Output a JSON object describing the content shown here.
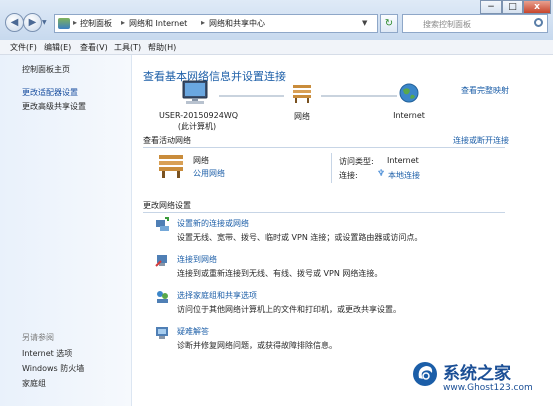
{
  "address_bar": {
    "crumbs": [
      "控制面板",
      "网络和 Internet",
      "网络和共享中心"
    ],
    "search_placeholder": "搜索控制面板"
  },
  "window_controls": {
    "minimize": "−",
    "maximize": "□",
    "close": "x"
  },
  "menu": [
    "文件(F)",
    "编辑(E)",
    "查看(V)",
    "工具(T)",
    "帮助(H)"
  ],
  "sidebar": {
    "items": [
      "控制面板主页",
      "更改适配器设置",
      "更改高级共享设置"
    ],
    "see_also_title": "另请参阅",
    "see_also": [
      "Internet 选项",
      "Windows 防火墙",
      "家庭组"
    ]
  },
  "main": {
    "title": "查看基本网络信息并设置连接",
    "view_full_map": "查看完整映射",
    "map": {
      "computer_name": "USER-20150924WQ",
      "computer_sub": "(此计算机)",
      "network": "网络",
      "internet": "Internet"
    },
    "active_title": "查看活动网络",
    "connect_disconnect": "连接或断开连接",
    "network_name": "网络",
    "network_type": "公用网络",
    "access_type_label": "访问类型:",
    "access_type_value": "Internet",
    "connections_label": "连接:",
    "connections_value": "本地连接",
    "change_title": "更改网络设置",
    "tasks": [
      {
        "title": "设置新的连接或网络",
        "desc": "设置无线、宽带、拨号、临时或 VPN 连接；或设置路由器或访问点。"
      },
      {
        "title": "连接到网络",
        "desc": "连接到或重新连接到无线、有线、拨号或 VPN 网络连接。"
      },
      {
        "title": "选择家庭组和共享选项",
        "desc": "访问位于其他网络计算机上的文件和打印机，或更改共享设置。"
      },
      {
        "title": "疑难解答",
        "desc": "诊断并修复网络问题，或获得故障排除信息。"
      }
    ]
  },
  "watermark": {
    "name": "系统之家",
    "url": "www.Ghost123.com"
  },
  "colors": {
    "link": "#1d5fa8",
    "titlebar": "#c7d9ee",
    "sidebar": "#e9f1fb"
  }
}
